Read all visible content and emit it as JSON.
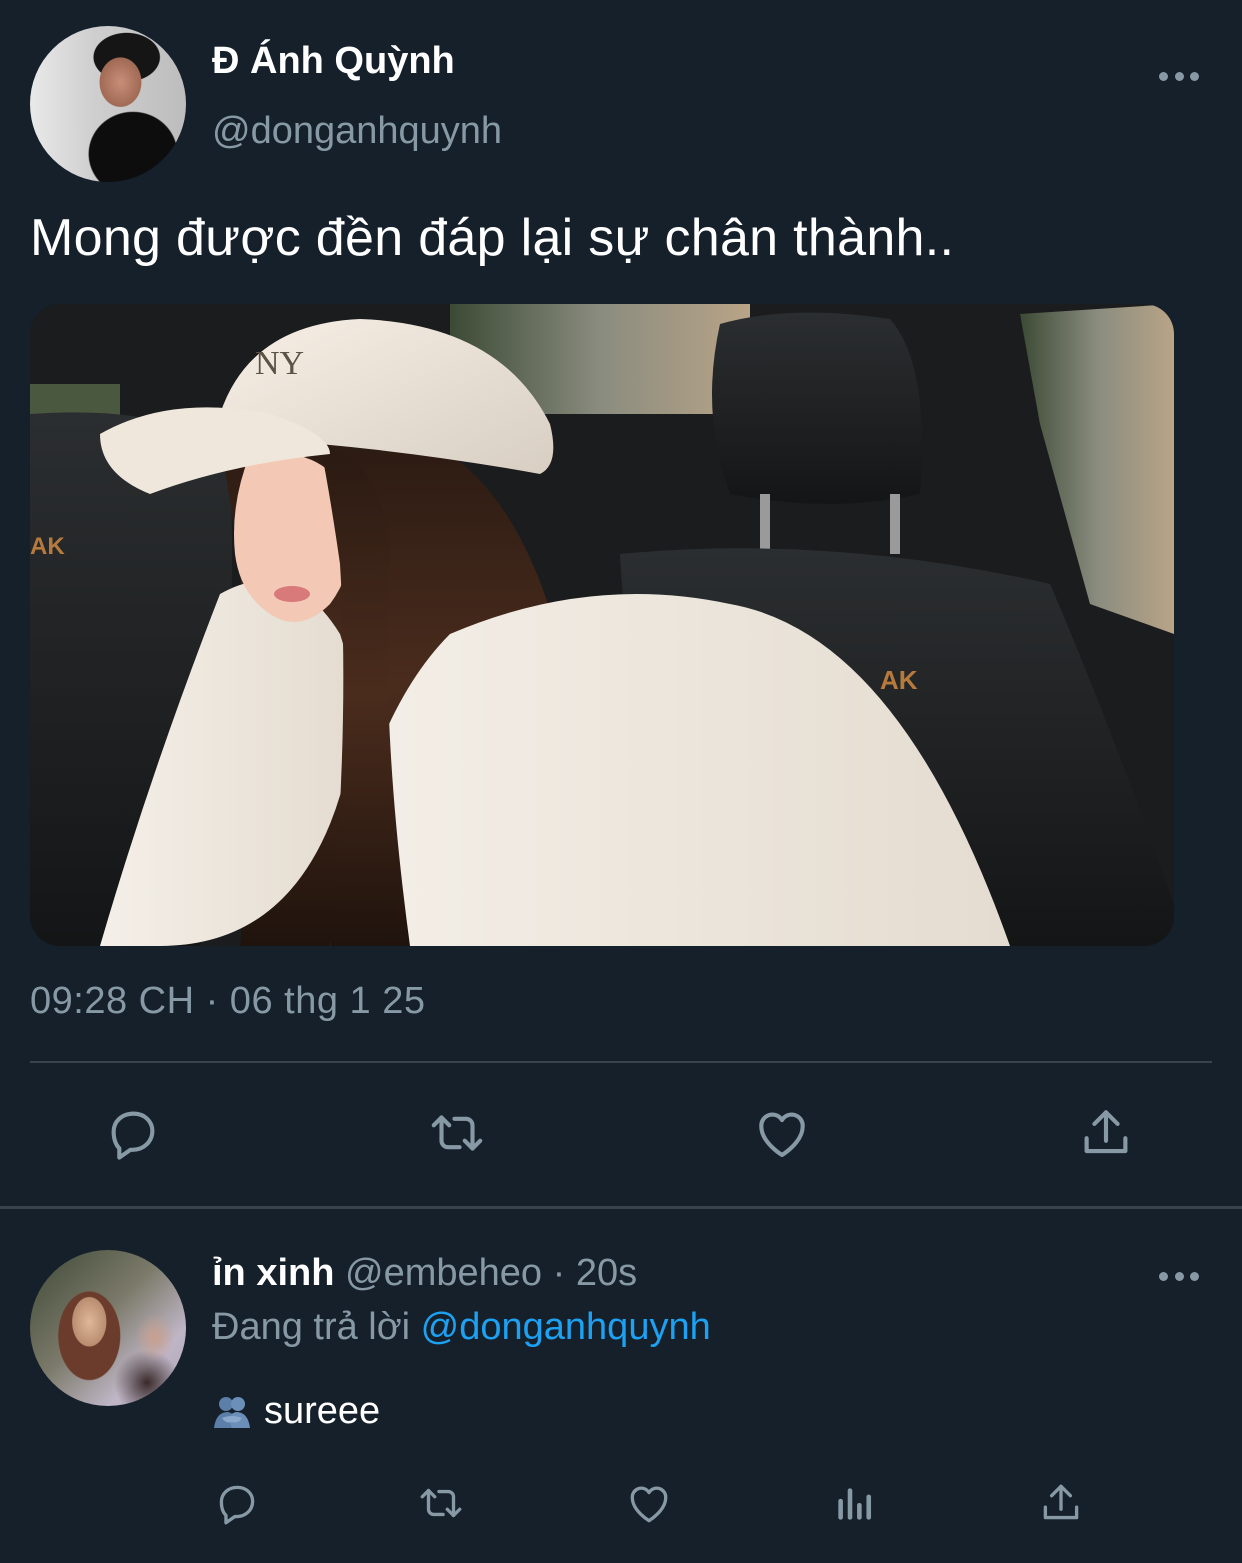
{
  "tweet": {
    "author": {
      "display_name": "Đ Ánh Quỳnh",
      "handle": "@donganhquynh",
      "avatar": "profile-photo"
    },
    "more_icon": "more-horizontal-icon",
    "text": "Mong được đền đáp lại sự chân thành..",
    "media": "photo",
    "timestamp": "09:28 CH · 06 thg 1 25",
    "actions": {
      "reply_icon": "reply-icon",
      "retweet_icon": "retweet-icon",
      "like_icon": "heart-icon",
      "share_icon": "share-icon"
    }
  },
  "reply": {
    "author": {
      "display_name": "ỉn xinh",
      "handle": "@embeheo",
      "separator": "·",
      "time": "20s",
      "avatar": "profile-photo"
    },
    "replying_to_label": "Đang trả lời",
    "replying_to_handle": "@donganhquynh",
    "emoji": "people-hugging-emoji",
    "text": "sureee",
    "actions": {
      "reply_icon": "reply-icon",
      "retweet_icon": "retweet-icon",
      "like_icon": "heart-icon",
      "stats_icon": "analytics-icon",
      "share_icon": "share-icon"
    }
  },
  "colors": {
    "background": "#15202b",
    "primary_text": "#ffffff",
    "secondary_text": "#8899a6",
    "link": "#1da1f2",
    "divider": "#38444d"
  }
}
